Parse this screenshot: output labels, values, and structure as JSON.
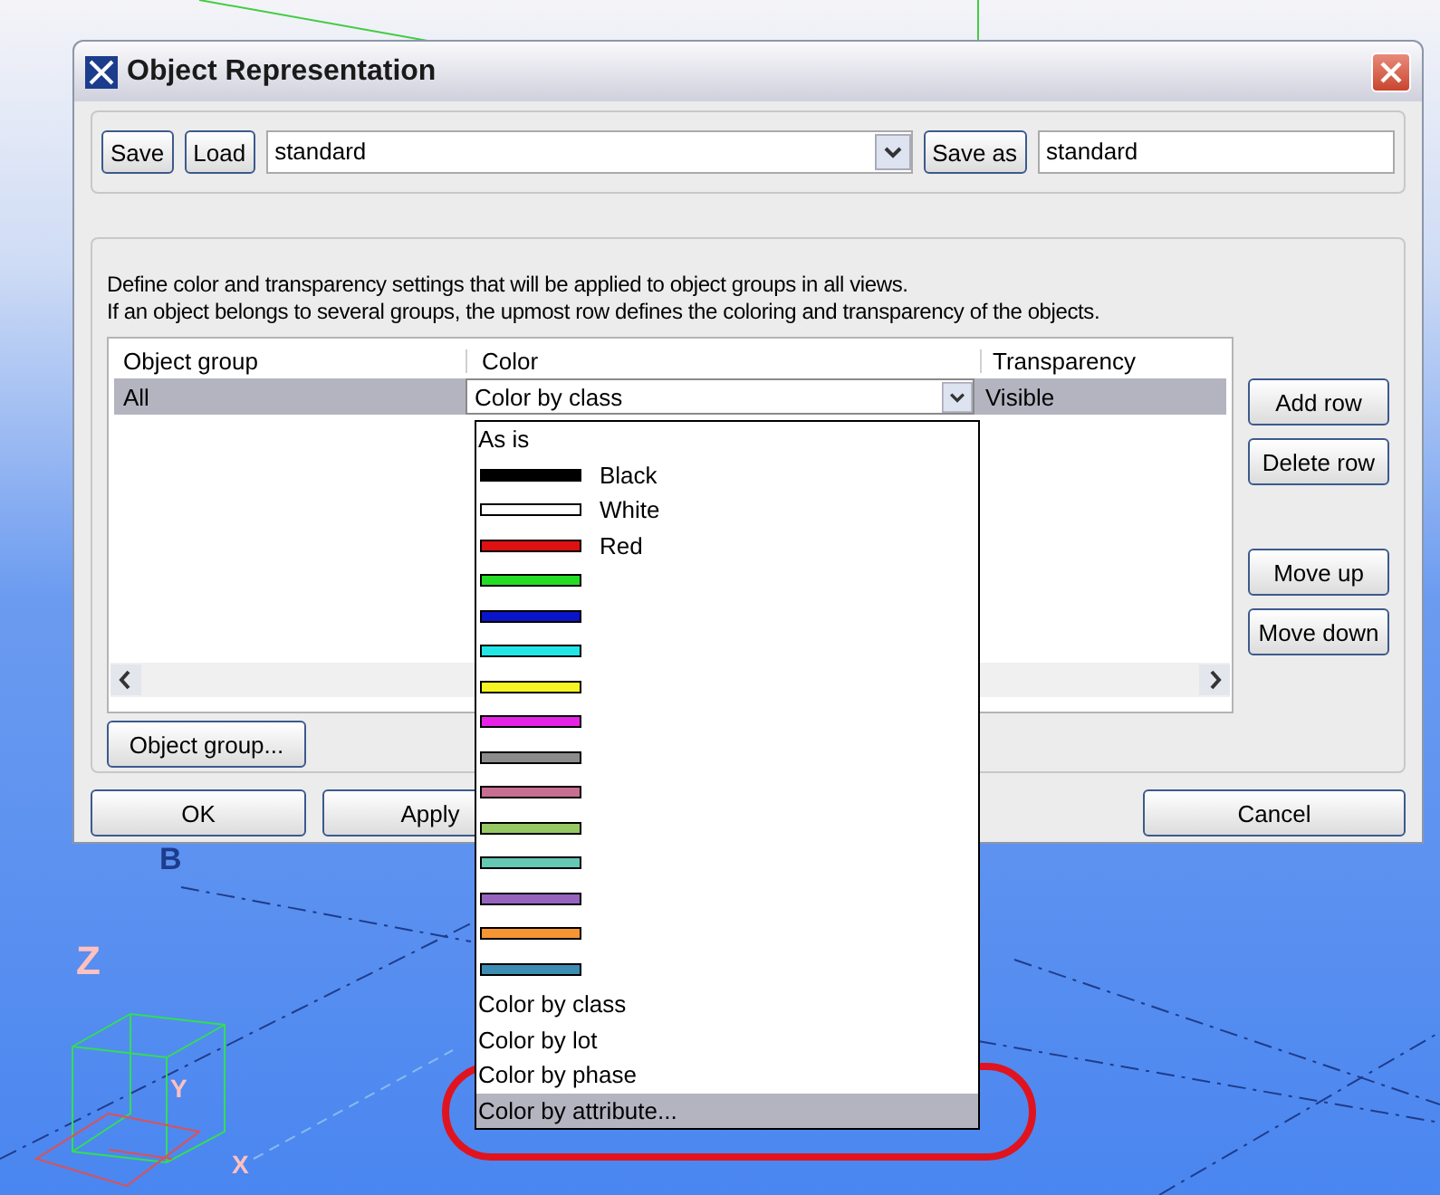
{
  "window": {
    "title": "Object Representation"
  },
  "preset": {
    "save": "Save",
    "load": "Load",
    "value": "standard",
    "save_as": "Save as",
    "save_as_value": "standard"
  },
  "description": [
    "Define color and transparency settings that will be applied to object groups in all views.",
    "If an object belongs to several groups, the upmost row defines the coloring and transparency of the objects."
  ],
  "table": {
    "columns": [
      "Object group",
      "Color",
      "Transparency"
    ],
    "rows": [
      {
        "object_group": "All",
        "color_mode": "Color by class",
        "transparency": "Visible",
        "selected": true
      }
    ]
  },
  "side_buttons": [
    [
      "Add row",
      "Delete row"
    ],
    [
      "Move up",
      "Move down"
    ]
  ],
  "object_group_button": "Object group...",
  "buttons": [
    "OK",
    "Apply",
    "Cancel"
  ],
  "dropdown": {
    "items": [
      {
        "kind": "text",
        "label": "As is",
        "selected": false
      },
      {
        "kind": "swatch",
        "label": "Black",
        "color": "#000000",
        "selected": false
      },
      {
        "kind": "swatch",
        "label": "White",
        "color": "#ffffff",
        "selected": false
      },
      {
        "kind": "swatch",
        "label": "Red",
        "color": "#dd1111",
        "selected": false
      },
      {
        "kind": "swatch",
        "color": "#22dd22",
        "selected": false
      },
      {
        "kind": "swatch",
        "color": "#0a14c8",
        "selected": false
      },
      {
        "kind": "swatch",
        "color": "#22e6e6",
        "selected": false
      },
      {
        "kind": "swatch",
        "color": "#f5f522",
        "selected": false
      },
      {
        "kind": "swatch",
        "color": "#e622e6",
        "selected": false
      },
      {
        "kind": "swatch",
        "color": "#8c8c8c",
        "selected": false
      },
      {
        "kind": "swatch",
        "color": "#c86e91",
        "selected": false
      },
      {
        "kind": "swatch",
        "color": "#96c864",
        "selected": false
      },
      {
        "kind": "swatch",
        "color": "#64c8b4",
        "selected": false
      },
      {
        "kind": "swatch",
        "color": "#9664be",
        "selected": false
      },
      {
        "kind": "swatch",
        "color": "#f59632",
        "selected": false
      },
      {
        "kind": "swatch",
        "color": "#3c8cb4",
        "selected": false
      },
      {
        "kind": "text",
        "label": "Color by class",
        "selected": false
      },
      {
        "kind": "text",
        "label": "Color by lot",
        "selected": false
      },
      {
        "kind": "text",
        "label": "Color by phase",
        "selected": false
      },
      {
        "kind": "text",
        "label": "Color by attribute...",
        "selected": true
      }
    ]
  },
  "viewport": {
    "labels": [
      "B",
      "Z",
      "Y",
      "X"
    ]
  }
}
